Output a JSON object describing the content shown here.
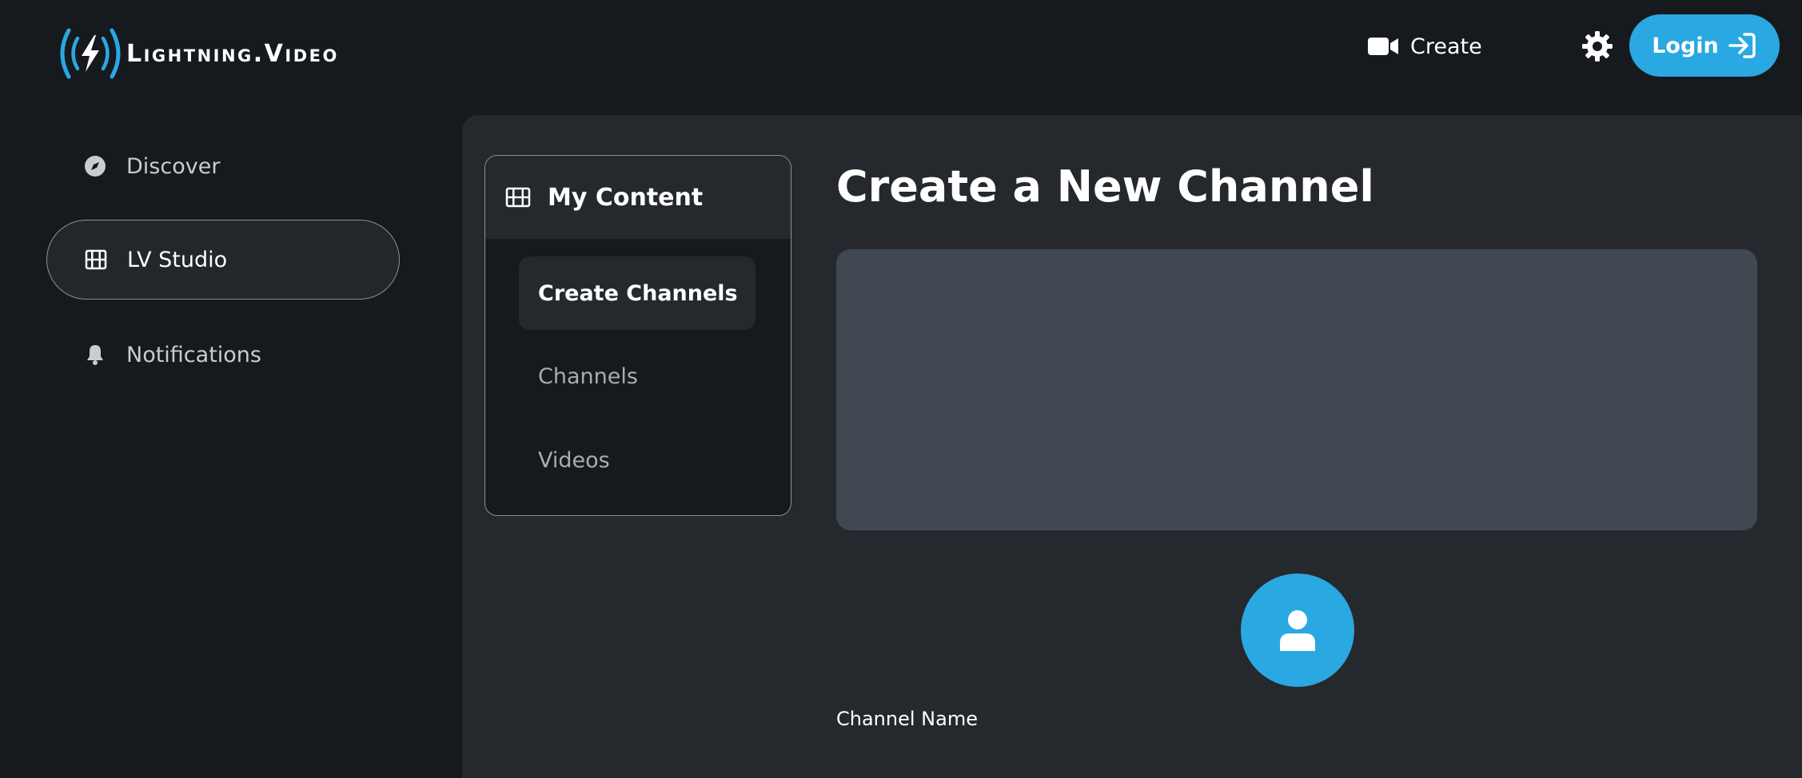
{
  "brand": {
    "name": "Lightning.Video",
    "accent_color": "#29a8e2",
    "logo_icon": "lightning-broadcast-icon"
  },
  "header": {
    "create_label": "Create",
    "create_icon": "video-camera-icon",
    "settings_icon": "gear-icon",
    "login_label": "Login",
    "login_icon": "login-arrow-icon"
  },
  "sidebar": {
    "items": [
      {
        "label": "Discover",
        "icon": "compass-icon",
        "active": false
      },
      {
        "label": "LV Studio",
        "icon": "film-icon",
        "active": true
      },
      {
        "label": "Notifications",
        "icon": "bell-icon",
        "active": false
      }
    ]
  },
  "content_menu": {
    "title": "My Content",
    "icon": "film-icon",
    "items": [
      {
        "label": "Create Channels",
        "active": true
      },
      {
        "label": "Channels",
        "active": false
      },
      {
        "label": "Videos",
        "active": false
      }
    ]
  },
  "main": {
    "title": "Create a New Channel",
    "avatar_icon": "user-icon",
    "channel_name_label": "Channel Name"
  }
}
